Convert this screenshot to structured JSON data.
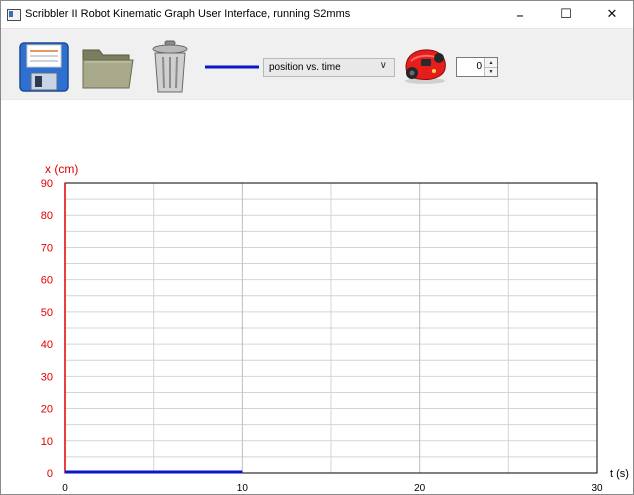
{
  "window": {
    "title": "Scribbler II Robot Kinematic Graph User Interface, running S2mms",
    "minimize_glyph": "–",
    "maximize_glyph": "☐",
    "close_glyph": "✕"
  },
  "toolbar": {
    "save_icon": "floppy-disk-icon",
    "open_icon": "folder-icon",
    "delete_icon": "trash-can-icon",
    "line_color": "#0a14c8",
    "plot_select": {
      "selected": "position vs. time",
      "arrow": "∨"
    },
    "robot_icon": "red-robot-icon",
    "spinner": {
      "value": "0",
      "up": "▲",
      "down": "▼"
    }
  },
  "chart_data": {
    "type": "line",
    "ylabel": "x (cm)",
    "xlabel": "t (s)",
    "xlim": [
      0,
      30
    ],
    "ylim": [
      0,
      90
    ],
    "x_ticks": [
      "0",
      "10",
      "20",
      "30"
    ],
    "y_ticks": [
      "0",
      "10",
      "20",
      "30",
      "40",
      "50",
      "60",
      "70",
      "80",
      "90"
    ],
    "grid": true,
    "axis_label_color": "#e00000",
    "series": [
      {
        "color": "#0a14c8",
        "x": [
          0,
          10
        ],
        "y": [
          0,
          0
        ]
      }
    ]
  }
}
